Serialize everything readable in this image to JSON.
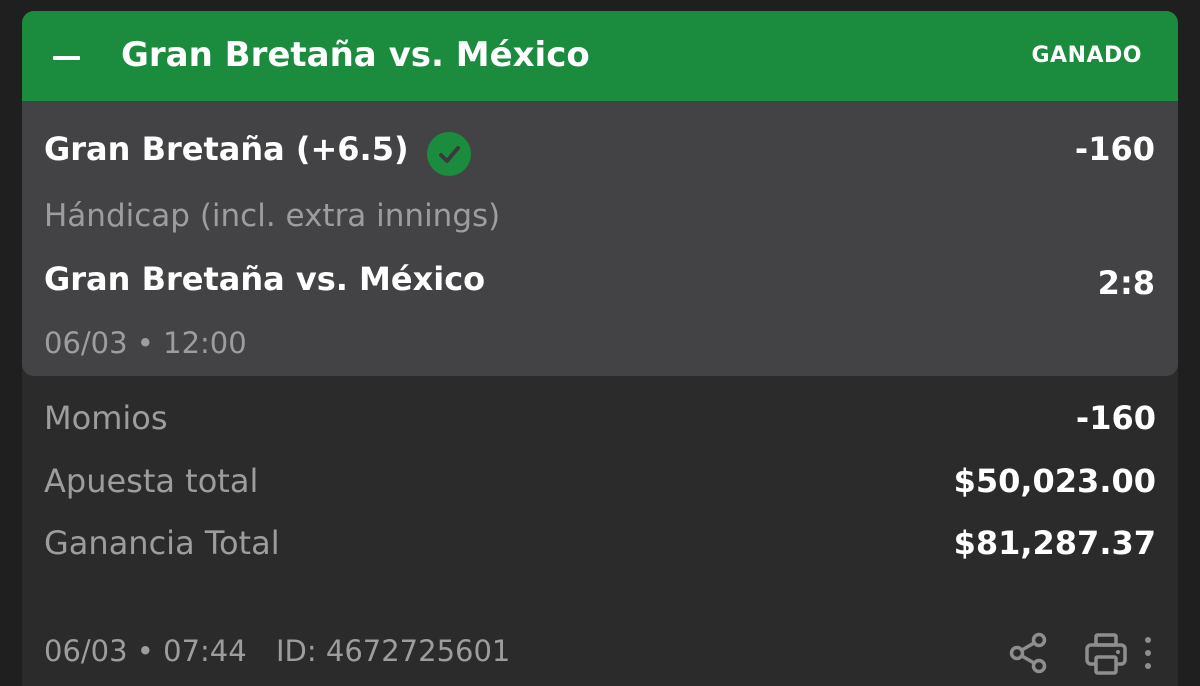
{
  "header": {
    "title": "Gran Bretaña vs. México",
    "status": "GANADO",
    "color": "#1b8c3e"
  },
  "selection": {
    "name": "Gran Bretaña (+6.5)",
    "odds": "-160",
    "market": "Hándicap (incl. extra innings)",
    "event": "Gran Bretaña vs. México",
    "score": "2:8",
    "datetime": "06/03 • 12:00",
    "status_icon": "check-circle-icon",
    "status_color": "#1b8c3e"
  },
  "summary": {
    "rows": [
      {
        "label": "Momios",
        "value": "-160"
      },
      {
        "label": "Apuesta total",
        "value": "$50,023.00"
      },
      {
        "label": "Ganancia Total",
        "value": "$81,287.37"
      }
    ]
  },
  "footer": {
    "datetime": "06/03 • 07:44",
    "id": "ID: 4672725601",
    "icons": [
      "share-icon",
      "print-icon",
      "more-vertical-icon"
    ]
  }
}
